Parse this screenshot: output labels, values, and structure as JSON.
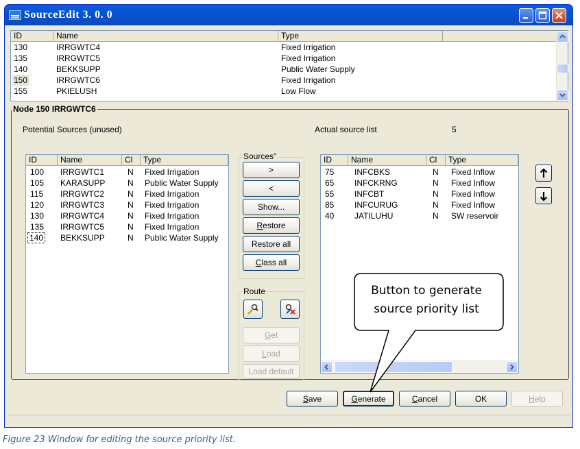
{
  "window": {
    "title": "SourceEdit 3. 0. 0",
    "caption_buttons": {
      "minimize": "minimize-icon",
      "maximize": "maximize-icon",
      "close": "close-icon"
    }
  },
  "node_list": {
    "headers": [
      "ID",
      "Name",
      "Type"
    ],
    "rows": [
      {
        "id": "130",
        "name": "IRRGWTC4",
        "type": "Fixed Irrigation"
      },
      {
        "id": "135",
        "name": "IRRGWTC5",
        "type": "Fixed Irrigation"
      },
      {
        "id": "140",
        "name": "BEKKSUPP",
        "type": "Public Water Supply"
      },
      {
        "id": "150",
        "name": "IRRGWTC6",
        "type": "Fixed Irrigation"
      },
      {
        "id": "155",
        "name": "PKIELUSH",
        "type": "Low Flow"
      }
    ]
  },
  "node_group": {
    "title": "Node 150 IRRGWTC6",
    "potential_label": "Potential Sources (unused)",
    "actual_label": "Actual source list",
    "actual_count": "5"
  },
  "potential_list": {
    "headers": [
      "ID",
      "Name",
      "Cl",
      "Type"
    ],
    "rows": [
      {
        "id": "100",
        "name": "IRRGWTC1",
        "cl": "N",
        "type": "Fixed Irrigation"
      },
      {
        "id": "105",
        "name": "KARASUPP",
        "cl": "N",
        "type": "Public Water Supply"
      },
      {
        "id": "115",
        "name": "IRRGWTC2",
        "cl": "N",
        "type": "Fixed Irrigation"
      },
      {
        "id": "120",
        "name": "IRRGWTC3",
        "cl": "N",
        "type": "Fixed Irrigation"
      },
      {
        "id": "130",
        "name": "IRRGWTC4",
        "cl": "N",
        "type": "Fixed Irrigation"
      },
      {
        "id": "135",
        "name": "IRRGWTC5",
        "cl": "N",
        "type": "Fixed Irrigation"
      },
      {
        "id": "140",
        "name": "BEKKSUPP",
        "cl": "N",
        "type": "Public Water Supply"
      }
    ]
  },
  "actual_list": {
    "headers": [
      "ID",
      "Name",
      "Cl",
      "Type"
    ],
    "rows": [
      {
        "id": "75",
        "name": "INFCBKS",
        "cl": "N",
        "type": "Fixed Inflow"
      },
      {
        "id": "65",
        "name": "INFCKRNG",
        "cl": "N",
        "type": "Fixed Inflow"
      },
      {
        "id": "55",
        "name": "INFCBT",
        "cl": "N",
        "type": "Fixed Inflow"
      },
      {
        "id": "85",
        "name": "INFCURUG",
        "cl": "N",
        "type": "Fixed Inflow"
      },
      {
        "id": "40",
        "name": "JATILUHU",
        "cl": "N",
        "type": "SW reservoir"
      }
    ]
  },
  "sources_group": {
    "title": "Sources\"",
    "add_label": ">",
    "remove_label": "<",
    "show_label": "Show...",
    "restore_label": "Restore",
    "restore_all_label": "Restore all",
    "class_all_label": "Class all"
  },
  "route_group": {
    "title": "Route",
    "route_icon_1": "route-pick-icon",
    "route_icon_2": "route-clear-icon",
    "get_label": "Get",
    "load_label": "Load",
    "load_default_label": "Load default"
  },
  "order": {
    "up_icon": "arrow-up-icon",
    "down_icon": "arrow-down-icon"
  },
  "footer": {
    "save_label": "Save",
    "generate_label": "Generate",
    "cancel_label": "Cancel",
    "ok_label": "OK",
    "help_label": "Help"
  },
  "callout": {
    "line1": "Button to generate",
    "line2": "source priority list"
  },
  "figure_caption": "Figure 23 Window for editing the source priority list."
}
